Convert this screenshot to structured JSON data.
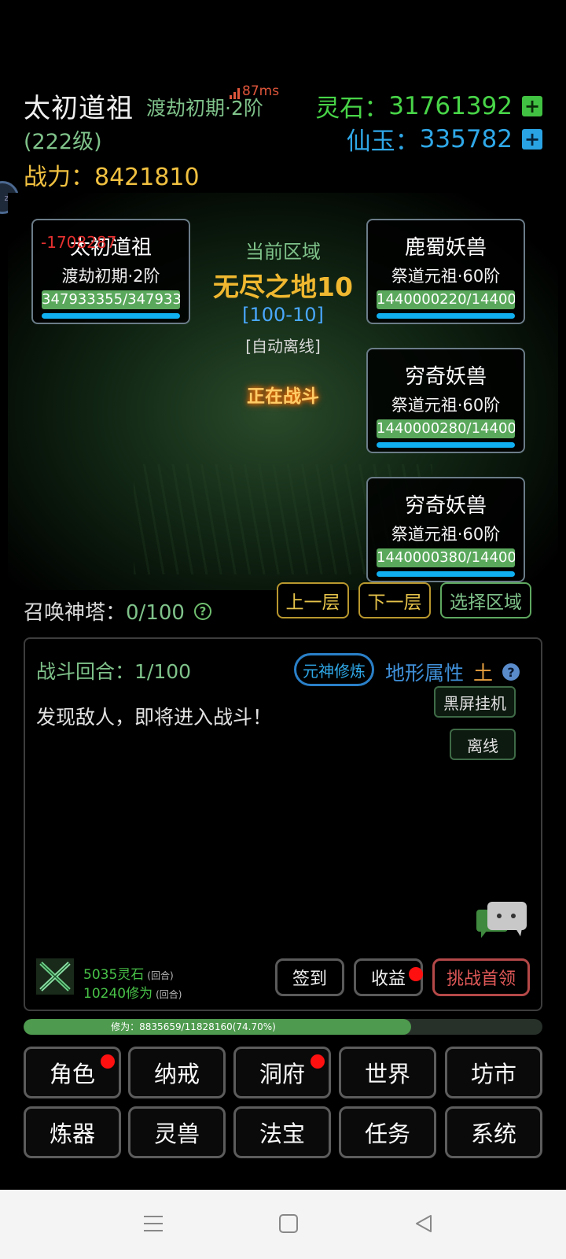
{
  "header": {
    "player_name": "太初道祖",
    "realm": "渡劫初期·2阶",
    "ping": "87ms",
    "level": "(222级)",
    "power": "战力：8421810",
    "spirit_stones_label": "灵石：",
    "spirit_stones_value": "31761392",
    "jade_label": "仙玉：",
    "jade_value": "335782",
    "plus_glyph": "+"
  },
  "battle": {
    "player_card": {
      "name": "太初道祖",
      "realm": "渡劫初期·2阶",
      "hp": "347933355/347933",
      "damage_text": "-1708287"
    },
    "zone": {
      "label": "当前区域",
      "name": "无尽之地10",
      "range": "[100-10]",
      "mode": "[自动离线]",
      "status": "正在战斗"
    },
    "enemies": [
      {
        "name": "鹿蜀妖兽",
        "realm": "祭道元祖·60阶",
        "hp": "1440000220/14400"
      },
      {
        "name": "穷奇妖兽",
        "realm": "祭道元祖·60阶",
        "hp": "1440000280/14400"
      },
      {
        "name": "穷奇妖兽",
        "realm": "祭道元祖·60阶",
        "hp": "1440000380/14400"
      }
    ]
  },
  "tower": {
    "label": "召唤神塔：",
    "value": "0/100",
    "help_glyph": "?",
    "prev_floor": "上一层",
    "next_floor": "下一层",
    "select_zone": "选择区域"
  },
  "panel": {
    "round": "战斗回合：1/100",
    "spirit_training": "元神修炼",
    "terrain_label": "地形属性",
    "terrain_value": "土",
    "help_glyph": "?",
    "log_line": "发现敌人，即将进入战斗！",
    "black_screen": "黑屏挂机",
    "offline": "离线",
    "reward_stones": "5035灵石",
    "reward_cultivation": "10240修为",
    "per_round": "(回合)",
    "sign_in": "签到",
    "earnings": "收益",
    "challenge_boss": "挑战首领"
  },
  "exp_bar": {
    "text": "修为：8835659/11828160(74.70%)",
    "percent": 74.7
  },
  "menu": {
    "row1": [
      "角色",
      "纳戒",
      "洞府",
      "世界",
      "坊市"
    ],
    "row2": [
      "炼器",
      "灵兽",
      "法宝",
      "任务",
      "系统"
    ]
  },
  "colors": {
    "spirit_stone": "#48d548",
    "jade": "#2fa8e8",
    "power": "#f0c040",
    "hp_bar": "#10b0f0"
  }
}
